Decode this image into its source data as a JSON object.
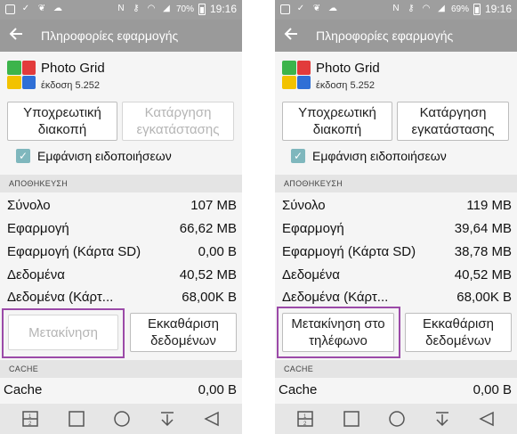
{
  "left": {
    "status": {
      "battery": "70%",
      "time": "19:16"
    },
    "toolbar": {
      "title": "Πληροφορίες εφαρμογής"
    },
    "app": {
      "name": "Photo Grid",
      "version": "έκδοση 5.252"
    },
    "buttons": {
      "force_stop": "Υποχρεωτική διακοπή",
      "uninstall": "Κατάργηση εγκατάστασης"
    },
    "notifications_label": "Εμφάνιση ειδοποιήσεων",
    "storage": {
      "header": "ΑΠΟΘΗΚΕΥΣΗ",
      "rows": [
        {
          "label": "Σύνολο",
          "value": "107 MB"
        },
        {
          "label": "Εφαρμογή",
          "value": "66,62 MB"
        },
        {
          "label": "Εφαρμογή (Κάρτα SD)",
          "value": "0,00 B"
        },
        {
          "label": "Δεδομένα",
          "value": "40,52 MB"
        },
        {
          "label": "Δεδομένα (Κάρτ...",
          "value": "68,00K B"
        }
      ],
      "move_button": "Μετακίνηση",
      "clear_data_button": "Εκκαθάριση δεδομένων"
    },
    "cache": {
      "header": "CACHE",
      "label": "Cache",
      "value": "0,00 B"
    }
  },
  "right": {
    "status": {
      "battery": "69%",
      "time": "19:16"
    },
    "toolbar": {
      "title": "Πληροφορίες εφαρμογής"
    },
    "app": {
      "name": "Photo Grid",
      "version": "έκδοση 5.252"
    },
    "buttons": {
      "force_stop": "Υποχρεωτική διακοπή",
      "uninstall": "Κατάργηση εγκατάστασης"
    },
    "notifications_label": "Εμφάνιση ειδοποιήσεων",
    "storage": {
      "header": "ΑΠΟΘΗΚΕΥΣΗ",
      "rows": [
        {
          "label": "Σύνολο",
          "value": "119 MB"
        },
        {
          "label": "Εφαρμογή",
          "value": "39,64 MB"
        },
        {
          "label": "Εφαρμογή (Κάρτα SD)",
          "value": "38,78 MB"
        },
        {
          "label": "Δεδομένα",
          "value": "40,52 MB"
        },
        {
          "label": "Δεδομένα (Κάρτ...",
          "value": "68,00K B"
        }
      ],
      "move_button": "Μετακίνηση στο τηλέφωνο",
      "clear_data_button": "Εκκαθάριση δεδομένων"
    },
    "cache": {
      "header": "CACHE",
      "label": "Cache",
      "value": "0,00 B"
    }
  },
  "icons": {
    "back": "arrow-left-icon",
    "nav": [
      "dual-window-icon",
      "square-icon",
      "circle-icon",
      "download-icon",
      "triangle-back-icon"
    ]
  },
  "colors": {
    "highlight": "#9b4aa8",
    "appbar": "#9a9a9a",
    "checkbox": "#7fb7bd"
  }
}
